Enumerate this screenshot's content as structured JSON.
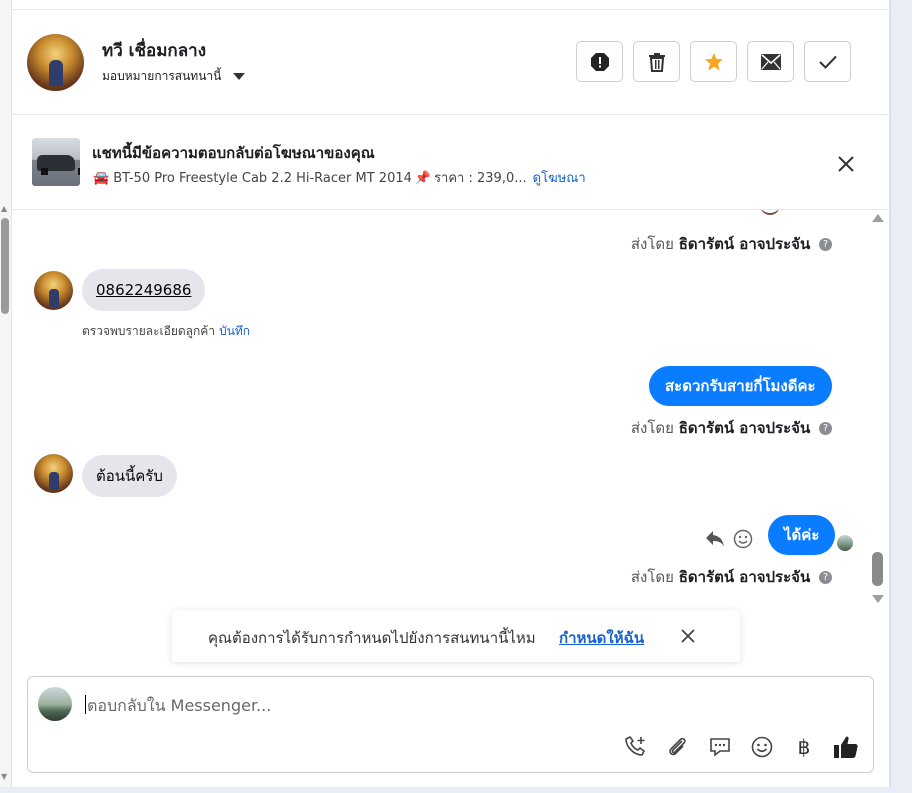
{
  "header": {
    "contact_name": "ทวี เชื่อมกลาง",
    "assign_label": "มอบหมายการสนทนานี้",
    "actions": [
      "spam-icon",
      "trash-icon",
      "star-icon",
      "envelope-icon",
      "check-icon"
    ]
  },
  "ad": {
    "title": "แชทนี้มีข้อความตอบกลับต่อโฆษณาของคุณ",
    "listing": "BT-50 Pro Freestyle Cab 2.2 Hi-Racer MT 2014",
    "price": "ราคา : 239,0...",
    "view_ad": "ดูโฆษณา"
  },
  "messages": {
    "sent_by_prefix": "ส่งโดย",
    "sender_name": "ธิดารัตน์ อาจประจัน",
    "info": "?",
    "incoming_phone": "0862249686",
    "detected_note": "ตรวจพบรายละเอียดลูกค้า",
    "save_label": "บันทึก",
    "outgoing_1": "สะดวกรับสายกี่โมงดีคะ",
    "incoming_2": "ต้อนนี้ครับ",
    "outgoing_2": "ได้ค่ะ"
  },
  "toast": {
    "text": "คุณต้องการได้รับการกำหนดไปยังการสนทนานี้ไหม",
    "action": "กำหนดให้ฉัน"
  },
  "composer": {
    "placeholder": "ตอบกลับใน Messenger...",
    "baht_symbol": "฿"
  },
  "colors": {
    "accent": "#0a7cff",
    "link": "#1763cf",
    "star": "#f5a623"
  }
}
